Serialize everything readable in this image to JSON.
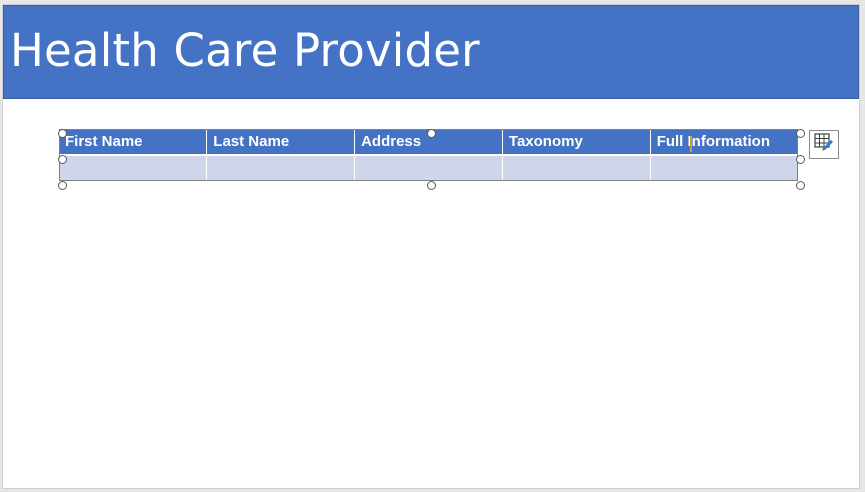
{
  "slide": {
    "title": "Health Care Provider"
  },
  "table": {
    "headers": [
      "First Name",
      "Last Name",
      "Address",
      "Taxonomy",
      "Full Information"
    ],
    "rows": [
      [
        "",
        "",
        "",
        "",
        ""
      ]
    ]
  },
  "colors": {
    "accent": "#4472c4",
    "row_fill": "#cfd5ea",
    "background": "#e6e6e6"
  },
  "icons": {
    "quick_layout": "table-layout-icon"
  }
}
